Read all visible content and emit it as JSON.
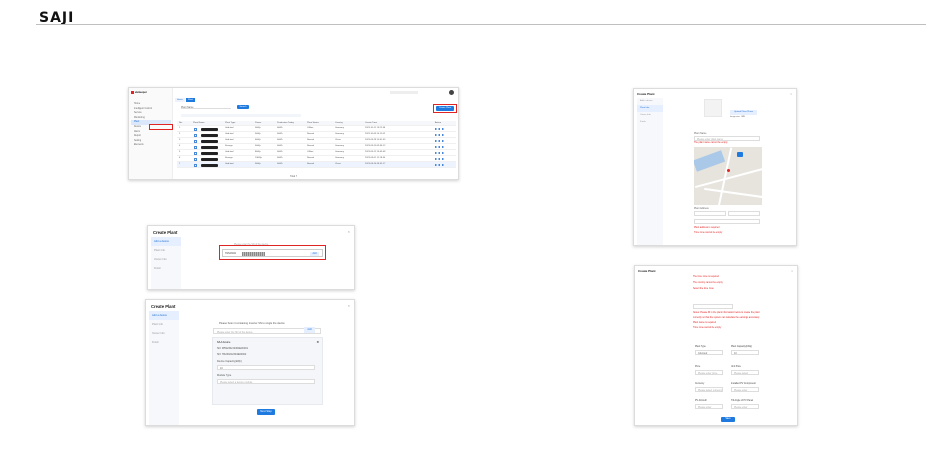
{
  "brand": {
    "name": "SAJI"
  },
  "plant_list": {
    "app_title": "elekeeper",
    "sidebar": [
      "Home",
      "Intelligent Control",
      "Service",
      "Monitoring",
      "Plant",
      "Device",
      "Alarm",
      "Report",
      "Setting",
      "Elements"
    ],
    "tabs": [
      "Home",
      "Plant"
    ],
    "search_label": "Plant Name",
    "search_button": "Search",
    "create_button": "Create Plant",
    "columns": [
      "No.",
      "Plant Name",
      "Plant Type",
      "Power",
      "Production Today",
      "Plant Status",
      "Country",
      "Create Time",
      "Action"
    ],
    "rows": [
      {
        "no": "1",
        "type": "Grid-tied",
        "power": "0kWp",
        "today": "0kWh",
        "status": "Offline",
        "country": "Germany",
        "time": "2023-10-11 15:22:36"
      },
      {
        "no": "2",
        "type": "Grid-tied",
        "power": "5kWp",
        "today": "0kWh",
        "status": "Normal",
        "country": "Germany",
        "time": "2023-10-09 14:11:02"
      },
      {
        "no": "3",
        "type": "Grid-tied",
        "power": "6kWp",
        "today": "0kWh",
        "status": "Normal",
        "country": "China",
        "time": "2023-09-28 10:41:55"
      },
      {
        "no": "4",
        "type": "Storage",
        "power": "5kWp",
        "today": "0kWh",
        "status": "Normal",
        "country": "Germany",
        "time": "2023-09-20 09:36:12"
      },
      {
        "no": "5",
        "type": "Grid-tied",
        "power": "8kWp",
        "today": "0kWh",
        "status": "Offline",
        "country": "Germany",
        "time": "2023-09-12 16:05:48"
      },
      {
        "no": "6",
        "type": "Storage",
        "power": "10kWp",
        "today": "0kWh",
        "status": "Normal",
        "country": "Germany",
        "time": "2023-09-01 11:18:30"
      },
      {
        "no": "7",
        "type": "Grid-tied",
        "power": "3kWp",
        "today": "0kWh",
        "status": "Normal",
        "country": "China",
        "time": "2023-08-24 08:52:17"
      }
    ],
    "pagination": "Total 7"
  },
  "create_plant_step1": {
    "title": "Create Plant",
    "steps": [
      "Add a device",
      "Plant Info",
      "Owner Info",
      "Finish"
    ],
    "hint": "Please enter the SN of the device",
    "sn_prefix": "H1S2302J",
    "add_button": "Add"
  },
  "create_plant_device": {
    "title": "Create Plant",
    "steps": [
      "Add a device",
      "Plant Info",
      "Owner Info",
      "Finish"
    ],
    "hint": "Please Scan it containing inverter SN to single the device",
    "placeholder": "Please enter the SN of the device",
    "add_button": "Add",
    "panel": {
      "title": "SAJ device",
      "sn1": "SN: M5S2302J2304E00001",
      "sn2": "SN: HS2302J2304E00002",
      "capacity_label": "Device Capacity(kWp)",
      "capacity_value": "10",
      "module_label": "Module Type",
      "module_placeholder": "Please select a device module"
    },
    "next_button": "Next Step"
  },
  "create_plant_map": {
    "title": "Create Plant",
    "steps": [
      "Add a device",
      "Plant Info",
      "Owner Info",
      "Finish"
    ],
    "upload_button": "Upload Plant Photo",
    "upload_hint": "Image size: 1MB",
    "name_label": "Plant Name",
    "name_placeholder": "Please enter plant name",
    "address_label": "Plant Address",
    "warnings": [
      "The plant name cannot be empty",
      "Plant address is required",
      "Time zone cannot be empty"
    ]
  },
  "create_plant_form": {
    "title": "Create Plant",
    "warnings": [
      "The time zone is required",
      "The country cannot be empty",
      "Select the time zone",
      "Notes: Please fill in the plant information below to create the plant",
      "correctly so that the system can calculate the earnings accurately",
      "Plant name is required",
      "Time zone cannot be empty"
    ],
    "fields": [
      {
        "label": "Plant Type",
        "value": "Grid-tied"
      },
      {
        "label": "Plant Capacity(kWp)",
        "value": "10"
      },
      {
        "label": "Price",
        "value": "Please enter price"
      },
      {
        "label": "Unit Price",
        "value": "Please select"
      },
      {
        "label": "Currency",
        "value": "Please select currency"
      },
      {
        "label": "Installed PV Component",
        "value": "Please enter"
      },
      {
        "label": "PV Azimuth",
        "value": "Please enter"
      },
      {
        "label": "Tilt Angle of PV Panel",
        "value": "Please enter"
      }
    ],
    "save_button": "Save"
  }
}
